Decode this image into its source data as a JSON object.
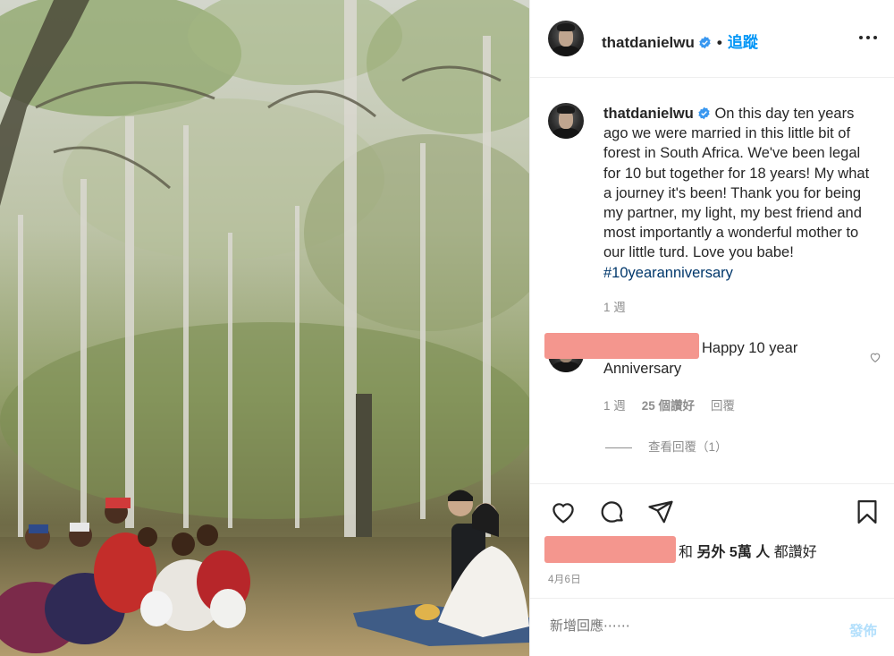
{
  "photo": {
    "alt_subject": "wedding-in-forest"
  },
  "header": {
    "username": "thatdanielwu",
    "separator": "•",
    "follow_label": "追蹤"
  },
  "caption": {
    "username": "thatdanielwu",
    "text": "On this day ten years ago we were married in this little bit of forest in South Africa. We've been legal for 10 but together for 18 years! My what a journey it's been! Thank you for being my partner, my light, my best friend and most importantly a wonderful mother to our little turd. Love you babe! ",
    "hashtag": "#10yearanniversary",
    "time": "1 週"
  },
  "comment": {
    "text": "Happy 10 year Anniversary",
    "time": "1 週",
    "likes": "25 個讚好",
    "reply_label": "回覆",
    "view_replies": "查看回覆（1）"
  },
  "likes": {
    "prefix": "和",
    "others": "另外 5萬 人",
    "suffix": "都讚好"
  },
  "date": "4月6日",
  "comment_box": {
    "placeholder": "新增回應⋯⋯",
    "post_label": "發佈"
  },
  "colors": {
    "accent": "#0095f6",
    "hashtag": "#00376b",
    "muted": "#8e8e8e",
    "redaction": "#f4968e"
  }
}
